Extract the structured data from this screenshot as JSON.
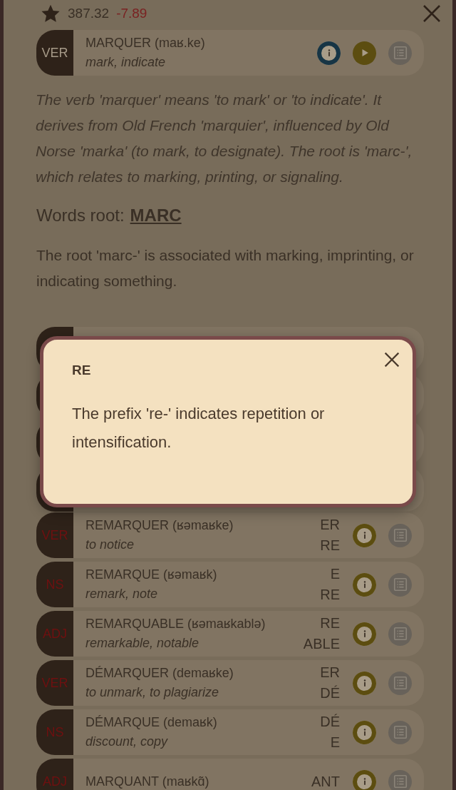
{
  "header": {
    "score": "387.32",
    "delta": "-7.89"
  },
  "word": {
    "pos": "VER",
    "title": "MARQUER (maʁ.ke)",
    "translation": "mark, indicate"
  },
  "etymology": "The verb 'marquer' means 'to mark' or 'to indicate'. It derives from Old French 'marquier', influenced by Old Norse 'marka' (to mark, to designate). The root is 'marc-', which relates to marking, printing, or signaling.",
  "root": {
    "label": "Words root:",
    "value": "MARC",
    "description": "The root 'marc-' is associated with marking, imprinting, or indicating something."
  },
  "related": [
    {
      "pos": "VER",
      "title": "REMARQUER (ʁəmaʁke)",
      "translation": "to notice",
      "affixes": [
        "ER",
        "RE"
      ]
    },
    {
      "pos": "NS",
      "title": "REMARQUE (ʁəmaʁk)",
      "translation": "remark, note",
      "affixes": [
        "E",
        "RE"
      ]
    },
    {
      "pos": "ADJ",
      "title": "REMARQUABLE (ʁəmaʁkablə)",
      "translation": "remarkable, notable",
      "affixes": [
        "RE",
        "ABLE"
      ]
    },
    {
      "pos": "VER",
      "title": "DÉMARQUER (demaʁke)",
      "translation": "to unmark, to plagiarize",
      "affixes": [
        "ER",
        "DÉ"
      ]
    },
    {
      "pos": "NS",
      "title": "DÉMARQUE (demaʁk)",
      "translation": "discount, copy",
      "affixes": [
        "DÉ",
        "E"
      ]
    },
    {
      "pos": "ADJ",
      "title": "MARQUANT (maʁkɑ̃)",
      "affixes": [
        "ANT"
      ]
    }
  ],
  "dialog": {
    "title": "RE",
    "text": "The prefix 're-' indicates repetition or intensification."
  }
}
